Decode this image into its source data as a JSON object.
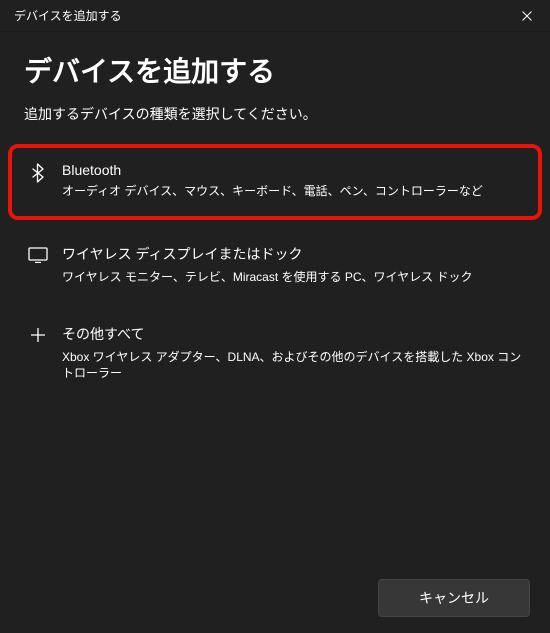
{
  "titlebar": {
    "title": "デバイスを追加する"
  },
  "page": {
    "title": "デバイスを追加する",
    "subtitle": "追加するデバイスの種類を選択してください。"
  },
  "options": [
    {
      "title": "Bluetooth",
      "desc": "オーディオ デバイス、マウス、キーボード、電話、ペン、コントローラーなど"
    },
    {
      "title": "ワイヤレス ディスプレイまたはドック",
      "desc": "ワイヤレス モニター、テレビ、Miracast を使用する PC、ワイヤレス ドック"
    },
    {
      "title": "その他すべて",
      "desc": "Xbox ワイヤレス アダプター、DLNA、およびその他のデバイスを搭載した Xbox コントローラー"
    }
  ],
  "footer": {
    "cancel": "キャンセル"
  }
}
